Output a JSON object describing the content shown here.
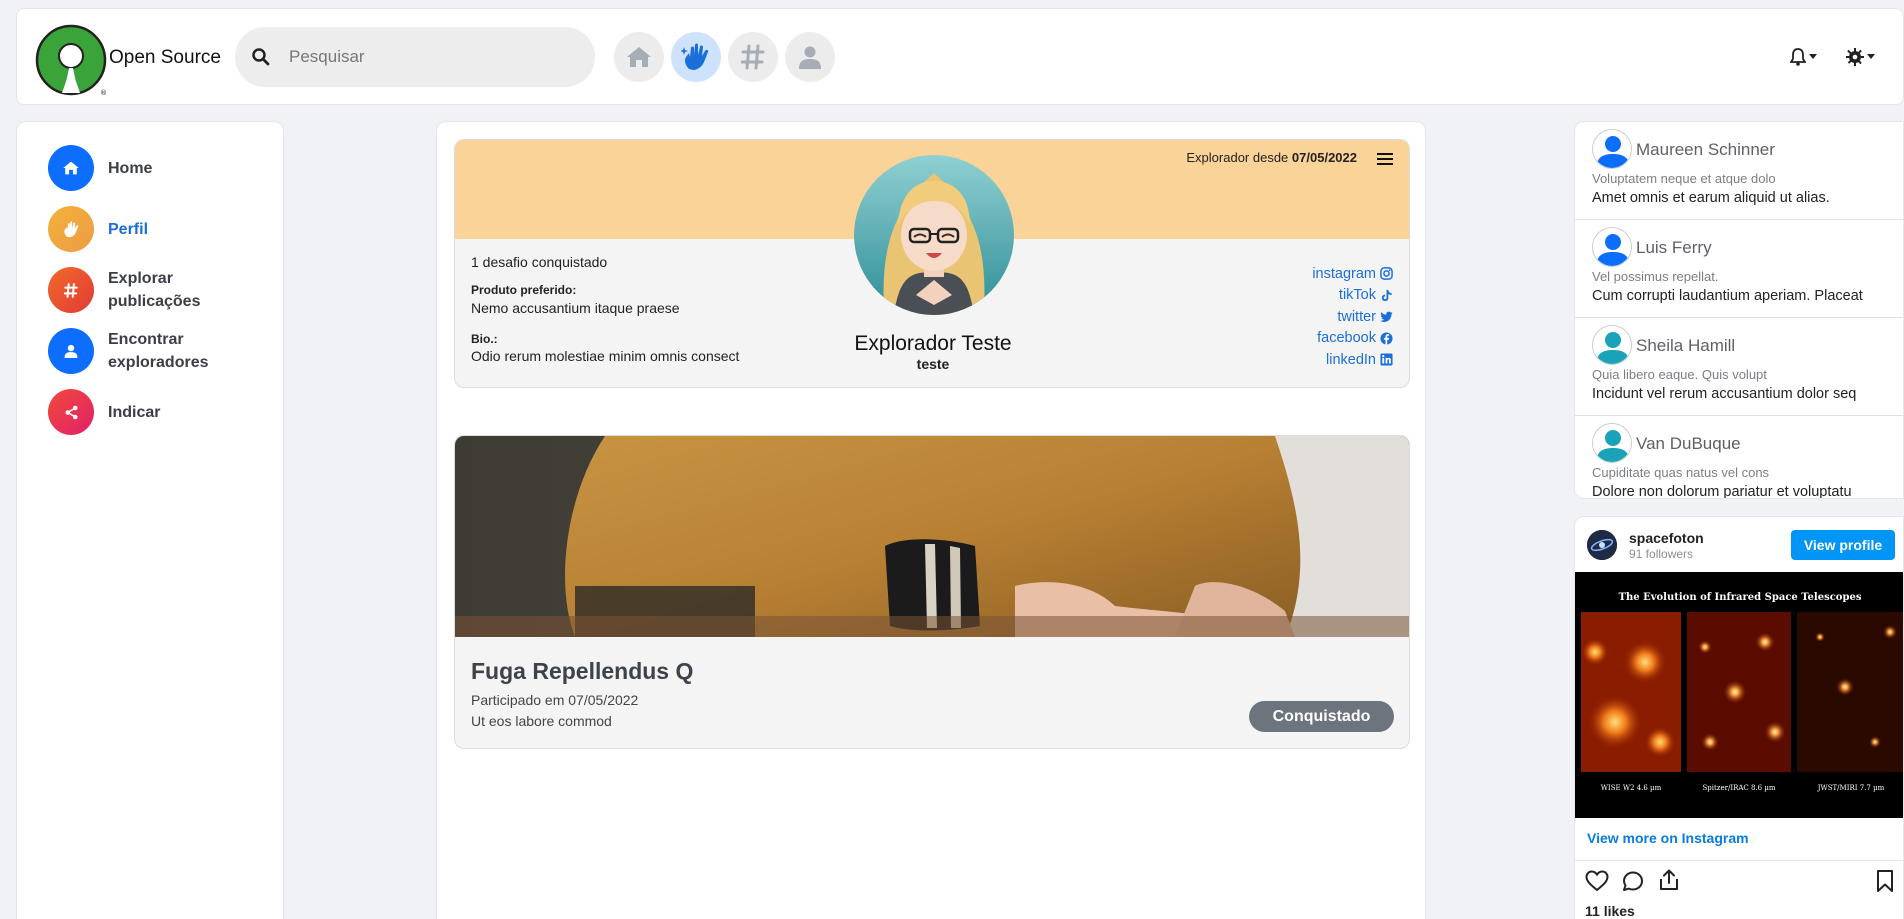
{
  "app": {
    "brand": "Open Source",
    "search_placeholder": "Pesquisar"
  },
  "sidebar": {
    "items": [
      {
        "label": "Home",
        "icon": "home-icon",
        "color": "#0d6efd"
      },
      {
        "label": "Perfil",
        "icon": "hand-icon",
        "color": "#f0a330"
      },
      {
        "label": "Explorar publicações",
        "icon": "hashtag-icon",
        "color": "#e8492e"
      },
      {
        "label": "Encontrar exploradores",
        "icon": "user-icon",
        "color": "#0d6efd"
      },
      {
        "label": "Indicar",
        "icon": "share-icon",
        "color": "#e8245d"
      }
    ]
  },
  "profile": {
    "since_prefix": "Explorador desde",
    "since_date": "07/05/2022",
    "name": "Explorador Teste",
    "username": "teste",
    "challenges": "1 desafio conquistado",
    "fav_label": "Produto preferido:",
    "fav_value": "Nemo accusantium itaque praese",
    "bio_label": "Bio.:",
    "bio_value": "Odio rerum molestiae minim omnis consect",
    "socials": [
      "instagram",
      "tikTok",
      "twitter",
      "facebook",
      "linkedIn"
    ]
  },
  "challenge": {
    "title": "Fuga Repellendus Q",
    "participated": "Participado em 07/05/2022",
    "description": "Ut eos labore commod",
    "badge": "Conquistado"
  },
  "contacts": [
    {
      "name": "Maureen Schinner",
      "sub": "Voluptatem neque et atque dolo",
      "msg": "Amet omnis et earum aliquid ut alias.",
      "avatar_color": "#0d6efd"
    },
    {
      "name": "Luis Ferry",
      "sub": "Vel possimus repellat.",
      "msg": "Cum corrupti laudantium aperiam. Placeat",
      "avatar_color": "#0d6efd"
    },
    {
      "name": "Sheila Hamill",
      "sub": "Quia libero eaque. Quis volupt",
      "msg": "Incidunt vel rerum accusantium dolor seq",
      "avatar_color": "#1aa2b8"
    },
    {
      "name": "Van DuBuque",
      "sub": "Cupiditate quas natus vel cons",
      "msg": "Dolore non dolorum pariatur et voluptatu",
      "avatar_color": "#1aa2b8"
    }
  ],
  "instagram": {
    "username": "spacefoton",
    "followers": "91 followers",
    "view_profile": "View profile",
    "image_title": "The Evolution of Infrared Space Telescopes",
    "image_labels": [
      "WISE W2 4.6 µm",
      "Spitzer/IRAC 8.6 µm",
      "JWST/MIRI 7.7 µm"
    ],
    "view_more": "View more on Instagram",
    "likes": "11 likes"
  }
}
